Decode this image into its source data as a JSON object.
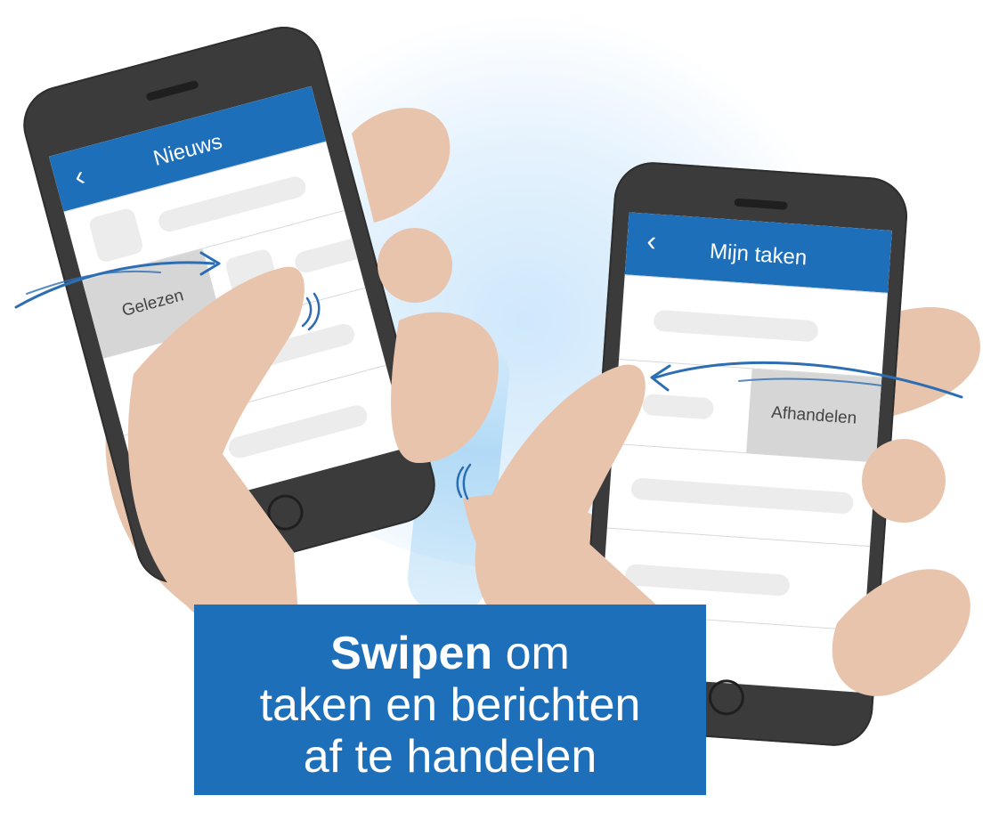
{
  "left_phone": {
    "title": "Nieuws",
    "back_glyph": "‹",
    "swipe_action": "Gelezen"
  },
  "right_phone": {
    "title": "Mijn taken",
    "back_glyph": "‹",
    "swipe_action": "Afhandelen"
  },
  "banner": {
    "bold": "Swipen",
    "line1_rest": " om",
    "line2": "taken en berichten",
    "line3": "af te handelen"
  },
  "colors": {
    "brand_blue": "#1e6fba",
    "skin": "#e8c4ad",
    "phone_body": "#3b3b3b",
    "placeholder": "#ececec",
    "action_bg": "#d6d6d6"
  }
}
